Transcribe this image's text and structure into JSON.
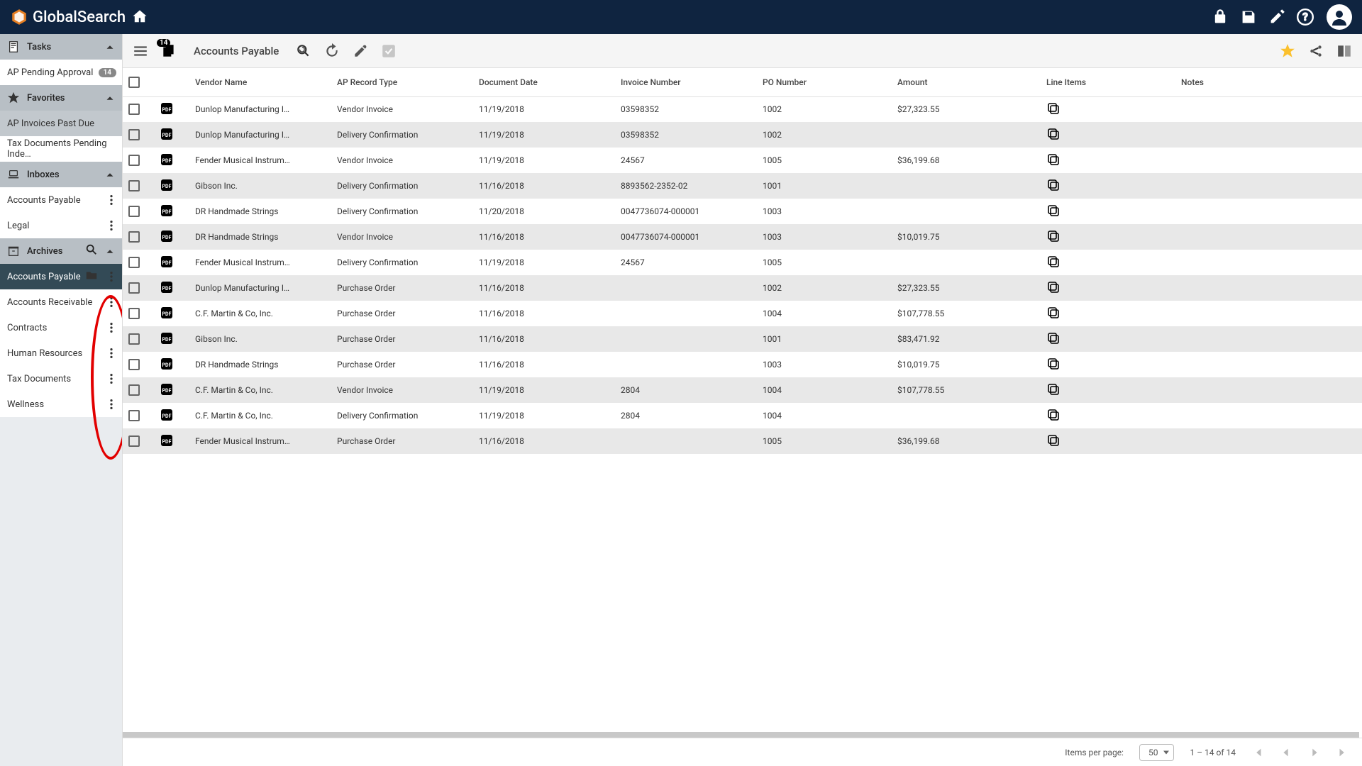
{
  "app": {
    "name": "GlobalSearch"
  },
  "sidebar": {
    "sections": [
      {
        "icon": "note",
        "label": "Tasks"
      },
      {
        "icon": "star",
        "label": "Favorites"
      },
      {
        "icon": "laptop",
        "label": "Inboxes"
      },
      {
        "icon": "archive",
        "label": "Archives"
      }
    ],
    "tasks": [
      {
        "label": "AP Pending Approval",
        "badge": "14"
      }
    ],
    "favorites": [
      {
        "label": "AP Invoices Past Due"
      },
      {
        "label": "Tax Documents Pending Inde…"
      }
    ],
    "inboxes": [
      {
        "label": "Accounts Payable"
      },
      {
        "label": "Legal"
      }
    ],
    "archives": [
      {
        "label": "Accounts Payable",
        "selected": true
      },
      {
        "label": "Accounts Receivable"
      },
      {
        "label": "Contracts"
      },
      {
        "label": "Human Resources"
      },
      {
        "label": "Tax Documents"
      },
      {
        "label": "Wellness"
      }
    ]
  },
  "toolbar": {
    "badge": "14",
    "title": "Accounts Payable"
  },
  "columns": {
    "vendor": "Vendor Name",
    "rectype": "AP Record Type",
    "docdate": "Document Date",
    "invno": "Invoice Number",
    "pono": "PO Number",
    "amount": "Amount",
    "lines": "Line Items",
    "notes": "Notes"
  },
  "rows": [
    {
      "vendor": "Dunlop Manufacturing I…",
      "rectype": "Vendor Invoice",
      "docdate": "11/19/2018",
      "invno": "03598352",
      "pono": "1002",
      "amount": "$27,323.55"
    },
    {
      "vendor": "Dunlop Manufacturing I…",
      "rectype": "Delivery Confirmation",
      "docdate": "11/19/2018",
      "invno": "03598352",
      "pono": "1002",
      "amount": ""
    },
    {
      "vendor": "Fender Musical Instrum…",
      "rectype": "Vendor Invoice",
      "docdate": "11/19/2018",
      "invno": "24567",
      "pono": "1005",
      "amount": "$36,199.68"
    },
    {
      "vendor": "Gibson Inc.",
      "rectype": "Delivery Confirmation",
      "docdate": "11/16/2018",
      "invno": "8893562-2352-02",
      "pono": "1001",
      "amount": ""
    },
    {
      "vendor": "DR Handmade Strings",
      "rectype": "Delivery Confirmation",
      "docdate": "11/20/2018",
      "invno": "0047736074-000001",
      "pono": "1003",
      "amount": ""
    },
    {
      "vendor": "DR Handmade Strings",
      "rectype": "Vendor Invoice",
      "docdate": "11/16/2018",
      "invno": "0047736074-000001",
      "pono": "1003",
      "amount": "$10,019.75"
    },
    {
      "vendor": "Fender Musical Instrum…",
      "rectype": "Delivery Confirmation",
      "docdate": "11/19/2018",
      "invno": "24567",
      "pono": "1005",
      "amount": ""
    },
    {
      "vendor": "Dunlop Manufacturing I…",
      "rectype": "Purchase Order",
      "docdate": "11/16/2018",
      "invno": "",
      "pono": "1002",
      "amount": "$27,323.55"
    },
    {
      "vendor": "C.F. Martin & Co, Inc.",
      "rectype": "Purchase Order",
      "docdate": "11/16/2018",
      "invno": "",
      "pono": "1004",
      "amount": "$107,778.55"
    },
    {
      "vendor": "Gibson Inc.",
      "rectype": "Purchase Order",
      "docdate": "11/16/2018",
      "invno": "",
      "pono": "1001",
      "amount": "$83,471.92"
    },
    {
      "vendor": "DR Handmade Strings",
      "rectype": "Purchase Order",
      "docdate": "11/16/2018",
      "invno": "",
      "pono": "1003",
      "amount": "$10,019.75"
    },
    {
      "vendor": "C.F. Martin & Co, Inc.",
      "rectype": "Vendor Invoice",
      "docdate": "11/19/2018",
      "invno": "2804",
      "pono": "1004",
      "amount": "$107,778.55"
    },
    {
      "vendor": "C.F. Martin & Co, Inc.",
      "rectype": "Delivery Confirmation",
      "docdate": "11/19/2018",
      "invno": "2804",
      "pono": "1004",
      "amount": ""
    },
    {
      "vendor": "Fender Musical Instrum…",
      "rectype": "Purchase Order",
      "docdate": "11/16/2018",
      "invno": "",
      "pono": "1005",
      "amount": "$36,199.68"
    }
  ],
  "pagination": {
    "label": "Items per page:",
    "size": "50",
    "range": "1 – 14 of 14"
  }
}
